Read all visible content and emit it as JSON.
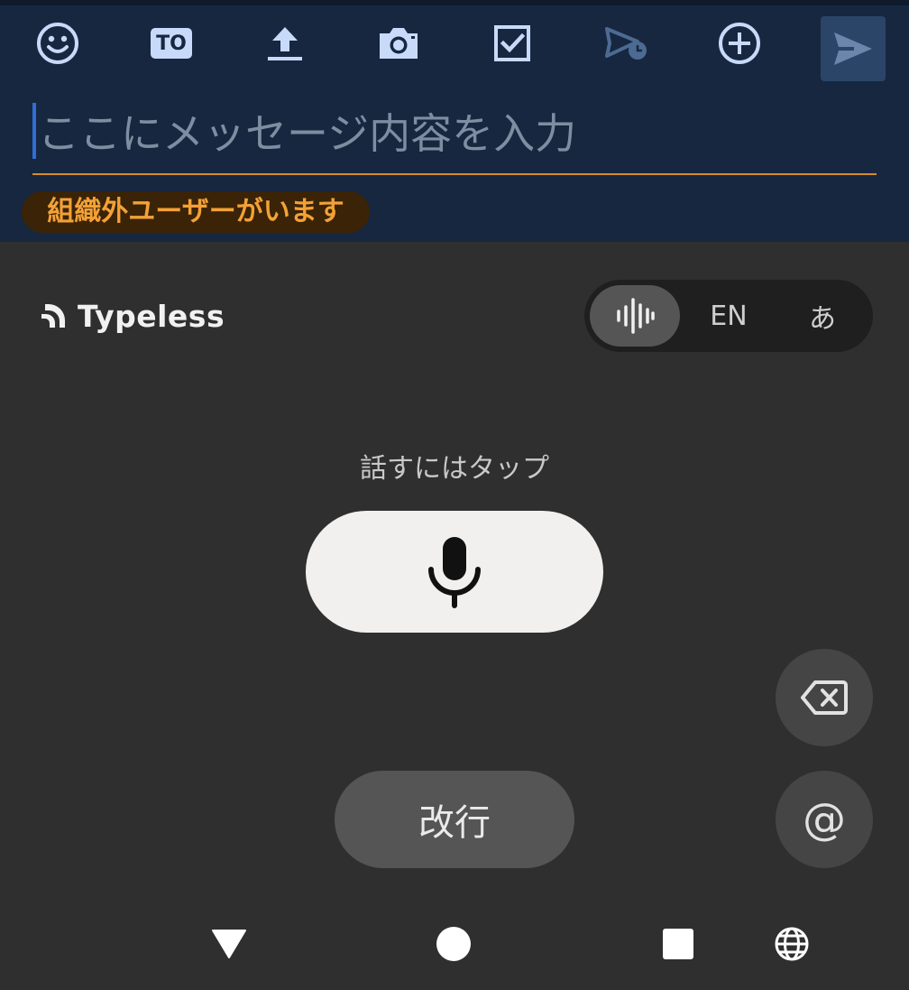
{
  "composer": {
    "toolbar": {
      "to_label": "TO"
    },
    "message_placeholder": "ここにメッセージ内容を入力",
    "warning_badge": "組織外ユーザーがいます"
  },
  "keyboard": {
    "brand_name": "Typeless",
    "mode_switch": {
      "en_label": "EN",
      "ja_label": "あ",
      "active": "voice"
    },
    "hint": "話すにはタップ",
    "newline_label": "改行",
    "at_label": "@"
  },
  "colors": {
    "composer_bg": "#172740",
    "accent_underline": "#d98b2b",
    "warning_text": "#f3a136",
    "icon_light": "#c8dafa",
    "keyboard_bg": "#2f2f2f"
  }
}
